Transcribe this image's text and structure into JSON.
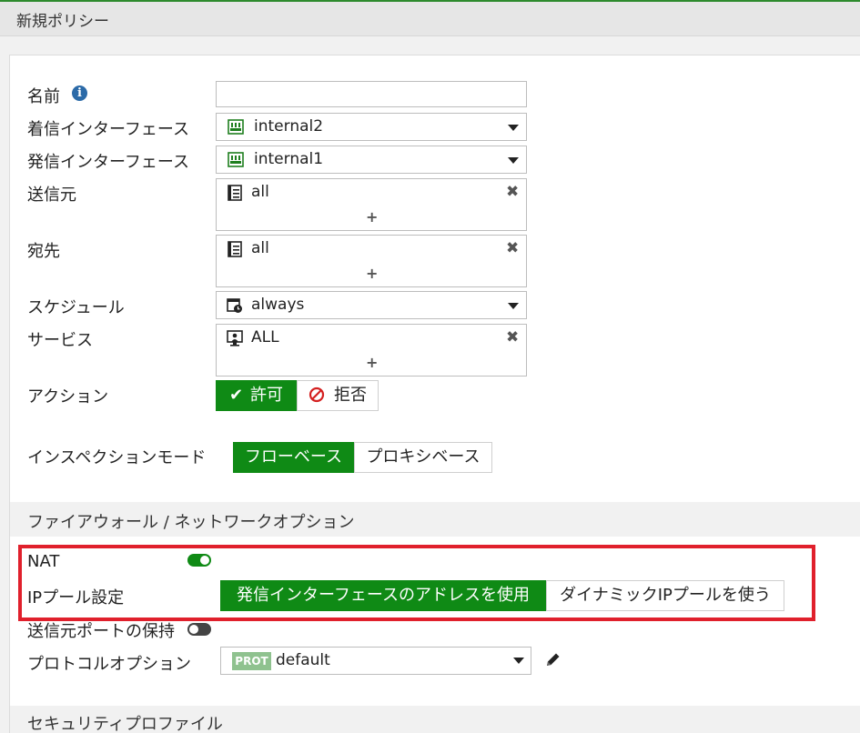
{
  "header": {
    "title": "新規ポリシー"
  },
  "form": {
    "name": {
      "label": "名前",
      "value": ""
    },
    "incoming_interface": {
      "label": "着信インターフェース",
      "value": "internal2"
    },
    "outgoing_interface": {
      "label": "発信インターフェース",
      "value": "internal1"
    },
    "source": {
      "label": "送信元",
      "value": "all"
    },
    "destination": {
      "label": "宛先",
      "value": "all"
    },
    "schedule": {
      "label": "スケジュール",
      "value": "always"
    },
    "service": {
      "label": "サービス",
      "value": "ALL"
    },
    "action": {
      "label": "アクション",
      "accept": "許可",
      "deny": "拒否",
      "selected": "accept"
    },
    "inspection_mode": {
      "label": "インスペクションモード",
      "flow": "フローベース",
      "proxy": "プロキシベース",
      "selected": "flow"
    }
  },
  "firewall_section": {
    "title": "ファイアウォール / ネットワークオプション",
    "nat": {
      "label": "NAT",
      "enabled": true
    },
    "ip_pool": {
      "label": "IPプール設定",
      "use_outgoing": "発信インターフェースのアドレスを使用",
      "dynamic": "ダイナミックIPプールを使う",
      "selected": "use_outgoing"
    },
    "preserve_source_port": {
      "label": "送信元ポートの保持",
      "enabled": false
    },
    "protocol_options": {
      "label": "プロトコルオプション",
      "badge": "PROT",
      "value": "default"
    }
  },
  "security_section": {
    "title": "セキュリティプロファイル"
  },
  "colors": {
    "accent": "#0f8a15",
    "highlight": "#e0202c",
    "info": "#2b6aa8"
  }
}
